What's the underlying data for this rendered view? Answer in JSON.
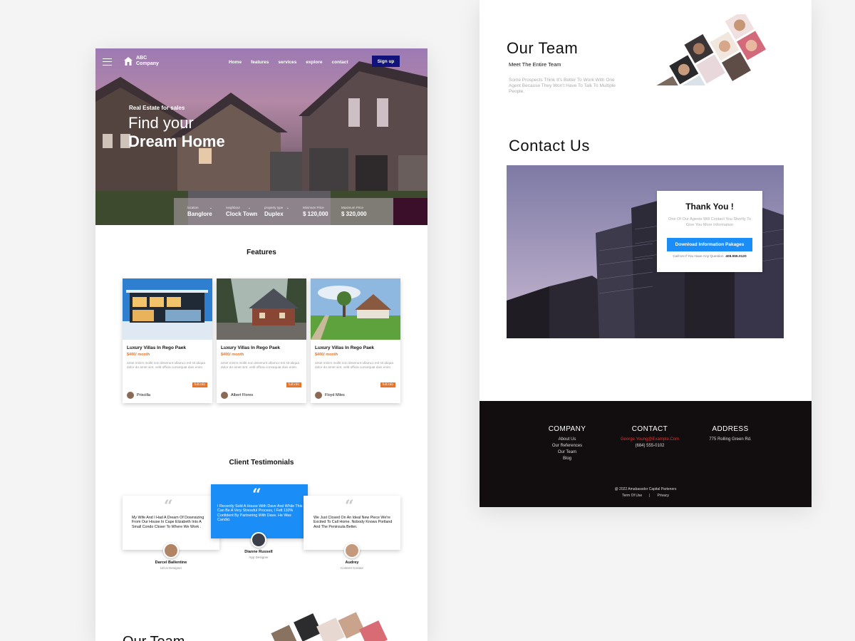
{
  "left_page": {
    "nav": {
      "logo_line1": "ABC",
      "logo_line2": "Company",
      "links": [
        "Home",
        "features",
        "services",
        "explore",
        "contact"
      ],
      "signup_label": "Sign up"
    },
    "hero": {
      "subtitle": "Real Estate for sales",
      "title_line1": "Find your",
      "title_line2": "Dream Home"
    },
    "search": [
      {
        "label": "location",
        "value": "Banglore"
      },
      {
        "label": "neighbour",
        "value": "Clock Town"
      },
      {
        "label": "property type",
        "value": "Duplex"
      },
      {
        "label": "Minimum Price",
        "value": "$ 120,000"
      },
      {
        "label": "Maximum Price",
        "value": "$ 320,000"
      }
    ],
    "features_title": "Features",
    "cards": [
      {
        "title": "Luxury Villas  In Rego Paek",
        "price": "$400/ month",
        "desc": "amet minim mollit non deserunt ullamco est sit aliqua dolor do amet sint. velit officia consequat duis enim.",
        "button": "full info",
        "author": "Priscilla"
      },
      {
        "title": "Luxury Villas  In Rego Paek",
        "price": "$400/ month",
        "desc": "amet minim mollit non deserunt ullamco est sit aliqua dolor do amet sint. velit officia consequat duis enim.",
        "button": "full info",
        "author": "Albert Flores"
      },
      {
        "title": "Luxury Villas  In Rego Paek",
        "price": "$400/ month",
        "desc": "amet minim mollit non deserunt ullamco est sit aliqua dolor do amet sint. velit officia consequat duis enim.",
        "button": "full info",
        "author": "Floyd Miles"
      }
    ],
    "testimonials_title": "Client Testimonials",
    "testimonials": [
      {
        "text": "My Wife And I Had A Dream Of Downsizing From Our House In Cape Elizabeth Into A Small Condo Closer To Where We Work .",
        "name": "Darcel Ballentine",
        "role": "Ui/Ux Designer"
      },
      {
        "text": "I Recently Sold A House With Dave And While This Can Be A Very Stressful Process, I Felt 110% Confident By Partnering With Dave. He Was Candid.",
        "name": "Dianne Russell",
        "role": "App Designer"
      },
      {
        "text": "We Just Closed On An Ideal New Piece We're Excited To Call Home. Nobody Knows Portland And The Peninsula Better.",
        "name": "Audrey",
        "role": "Content Creator"
      }
    ],
    "bottom_team_title": "Our Team"
  },
  "right_page": {
    "team": {
      "title": "Our Team",
      "subtitle": "Meet The Entire Team",
      "desc": "Some Prospects Think It's Better To Work With One Agent Because They Won't Have To Talk To Multiple People."
    },
    "contact": {
      "title": "Contact Us",
      "thanks_title": "Thank You !",
      "thanks_desc": "One Of Our Agents Will Contact You Shortly To Give You More Information",
      "download_label": "Download Information Pakages",
      "call_text": "Call Us If You Have Any Question",
      "call_number": "408.555.0120"
    },
    "footer": {
      "company_head": "COMPANY",
      "company_links": [
        "About Us",
        "Our References",
        "Our Team",
        "Blog"
      ],
      "contact_head": "CONTACT",
      "contact_email": "George.Young@Example.Com",
      "contact_phone": "(684) 555-0102",
      "address_head": "ADDRESS",
      "address": "775 Rolling Green Rd.",
      "copyright": "@ 2022  Amabassdor Capital Parteners",
      "terms": "Term Of Use",
      "privacy": "Privacy"
    }
  },
  "colors": {
    "accent_blue": "#1a8ef6",
    "nav_button": "#11127a",
    "price_orange": "#e8742a",
    "footer_bg": "#120d0f",
    "email_red": "#e8322c"
  }
}
